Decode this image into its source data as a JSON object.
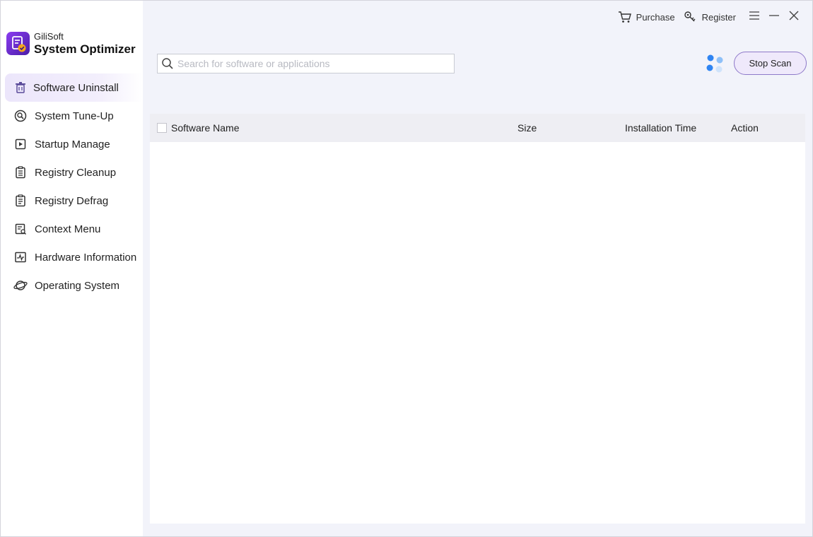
{
  "app": {
    "company": "GiliSoft",
    "product": "System Optimizer",
    "logo_color": "#7b2ff0"
  },
  "topbar": {
    "purchase_label": "Purchase",
    "register_label": "Register",
    "icons": [
      "cart-icon",
      "key-icon",
      "menu-icon",
      "minimize-icon",
      "close-icon"
    ]
  },
  "sidebar": {
    "items": [
      {
        "label": "Software Uninstall",
        "icon": "trash-icon",
        "active": true
      },
      {
        "label": "System Tune-Up",
        "icon": "tune-icon",
        "active": false
      },
      {
        "label": "Startup Manage",
        "icon": "startup-icon",
        "active": false
      },
      {
        "label": "Registry Cleanup",
        "icon": "registry-icon",
        "active": false
      },
      {
        "label": "Registry Defrag",
        "icon": "registry-defrag-icon",
        "active": false
      },
      {
        "label": "Context Menu",
        "icon": "context-menu-icon",
        "active": false
      },
      {
        "label": "Hardware Information",
        "icon": "hardware-icon",
        "active": false
      },
      {
        "label": "Operating System",
        "icon": "planet-icon",
        "active": false
      }
    ]
  },
  "search": {
    "placeholder": "Search for software or applications",
    "value": ""
  },
  "scan": {
    "stop_label": "Stop Scan",
    "accent": "#8e79c9",
    "spinner_color": "#3d8ef5"
  },
  "table": {
    "columns": [
      "Software Name",
      "Size",
      "Installation Time",
      "Action"
    ],
    "rows": []
  }
}
